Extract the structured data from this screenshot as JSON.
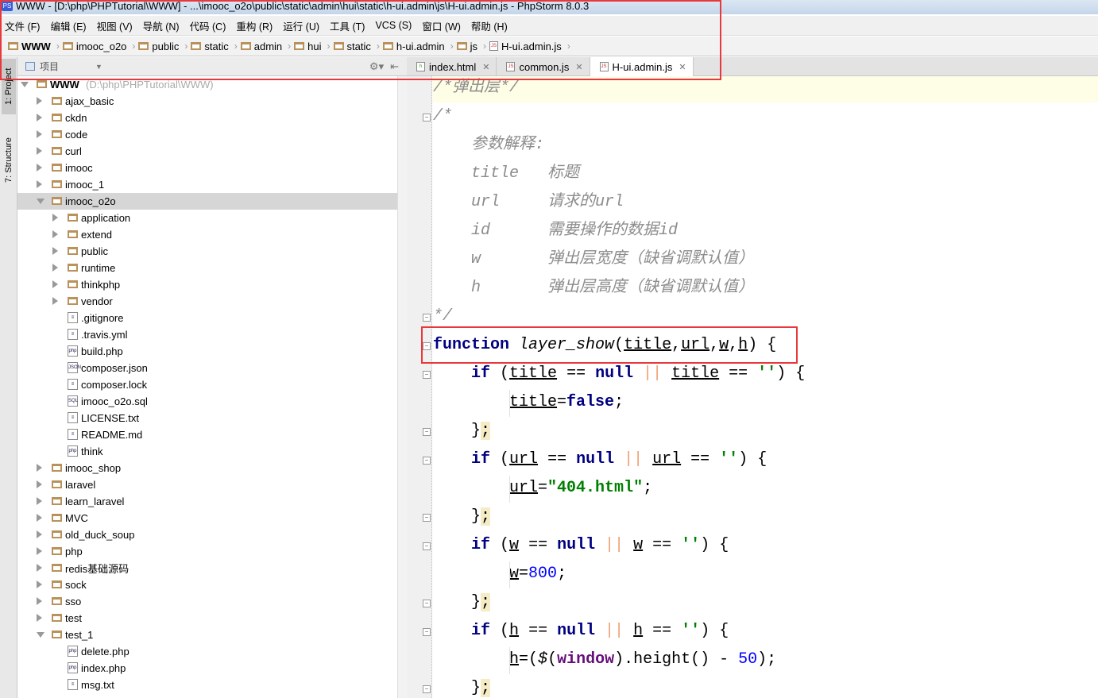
{
  "window": {
    "title": "WWW - [D:\\php\\PHPTutorial\\WWW] - ...\\imooc_o2o\\public\\static\\admin\\hui\\static\\h-ui.admin\\js\\H-ui.admin.js - PhpStorm 8.0.3"
  },
  "menu": [
    "文件 (F)",
    "编辑 (E)",
    "视图 (V)",
    "导航 (N)",
    "代码 (C)",
    "重构 (R)",
    "运行 (U)",
    "工具 (T)",
    "VCS (S)",
    "窗口 (W)",
    "帮助 (H)"
  ],
  "breadcrumb": [
    "WWW",
    "imooc_o2o",
    "public",
    "static",
    "admin",
    "hui",
    "static",
    "h-ui.admin",
    "js",
    "H-ui.admin.js"
  ],
  "sidebar": {
    "tabs": [
      "1: Project",
      "7: Structure"
    ],
    "panel_title": "项目"
  },
  "tabs": [
    {
      "label": "index.html",
      "icon": "html-file-icon"
    },
    {
      "label": "common.js",
      "icon": "js-file-icon"
    },
    {
      "label": "H-ui.admin.js",
      "icon": "js-file-icon",
      "active": true
    }
  ],
  "tree": [
    {
      "label": "WWW",
      "hint": "(D:\\php\\PHPTutorial\\WWW)",
      "depth": 0,
      "kind": "folder",
      "state": "open"
    },
    {
      "label": "ajax_basic",
      "depth": 1,
      "kind": "folder",
      "state": "closed"
    },
    {
      "label": "ckdn",
      "depth": 1,
      "kind": "folder",
      "state": "closed"
    },
    {
      "label": "code",
      "depth": 1,
      "kind": "folder",
      "state": "closed"
    },
    {
      "label": "curl",
      "depth": 1,
      "kind": "folder",
      "state": "closed"
    },
    {
      "label": "imooc",
      "depth": 1,
      "kind": "folder",
      "state": "closed"
    },
    {
      "label": "imooc_1",
      "depth": 1,
      "kind": "folder",
      "state": "closed"
    },
    {
      "label": "imooc_o2o",
      "depth": 1,
      "kind": "folder",
      "state": "open",
      "selected": true
    },
    {
      "label": "application",
      "depth": 2,
      "kind": "folder",
      "state": "closed"
    },
    {
      "label": "extend",
      "depth": 2,
      "kind": "folder",
      "state": "closed"
    },
    {
      "label": "public",
      "depth": 2,
      "kind": "folder",
      "state": "closed"
    },
    {
      "label": "runtime",
      "depth": 2,
      "kind": "folder",
      "state": "closed"
    },
    {
      "label": "thinkphp",
      "depth": 2,
      "kind": "folder",
      "state": "closed"
    },
    {
      "label": "vendor",
      "depth": 2,
      "kind": "folder",
      "state": "closed"
    },
    {
      "label": ".gitignore",
      "depth": 2,
      "kind": "text"
    },
    {
      "label": ".travis.yml",
      "depth": 2,
      "kind": "yml"
    },
    {
      "label": "build.php",
      "depth": 2,
      "kind": "php"
    },
    {
      "label": "composer.json",
      "depth": 2,
      "kind": "json"
    },
    {
      "label": "composer.lock",
      "depth": 2,
      "kind": "text"
    },
    {
      "label": "imooc_o2o.sql",
      "depth": 2,
      "kind": "sql"
    },
    {
      "label": "LICENSE.txt",
      "depth": 2,
      "kind": "text"
    },
    {
      "label": "README.md",
      "depth": 2,
      "kind": "text"
    },
    {
      "label": "think",
      "depth": 2,
      "kind": "php"
    },
    {
      "label": "imooc_shop",
      "depth": 1,
      "kind": "folder",
      "state": "closed"
    },
    {
      "label": "laravel",
      "depth": 1,
      "kind": "folder",
      "state": "closed"
    },
    {
      "label": "learn_laravel",
      "depth": 1,
      "kind": "folder",
      "state": "closed"
    },
    {
      "label": "MVC",
      "depth": 1,
      "kind": "folder",
      "state": "closed"
    },
    {
      "label": "old_duck_soup",
      "depth": 1,
      "kind": "folder",
      "state": "closed"
    },
    {
      "label": "php",
      "depth": 1,
      "kind": "folder",
      "state": "closed"
    },
    {
      "label": "redis基础源码",
      "depth": 1,
      "kind": "folder",
      "state": "closed"
    },
    {
      "label": "sock",
      "depth": 1,
      "kind": "folder",
      "state": "closed"
    },
    {
      "label": "sso",
      "depth": 1,
      "kind": "folder",
      "state": "closed"
    },
    {
      "label": "test",
      "depth": 1,
      "kind": "folder",
      "state": "closed"
    },
    {
      "label": "test_1",
      "depth": 1,
      "kind": "folder",
      "state": "open"
    },
    {
      "label": "delete.php",
      "depth": 2,
      "kind": "php"
    },
    {
      "label": "index.php",
      "depth": 2,
      "kind": "php"
    },
    {
      "label": "msg.txt",
      "depth": 2,
      "kind": "text"
    }
  ],
  "code": [
    {
      "fold": "",
      "hl": true,
      "tokens": [
        [
          "/*弹出层*/",
          "cm"
        ]
      ]
    },
    {
      "fold": "open",
      "tokens": [
        [
          "/*",
          "cm"
        ]
      ]
    },
    {
      "tokens": [
        [
          "    参数解释:",
          "cm"
        ]
      ]
    },
    {
      "tokens": [
        [
          "    title   标题",
          "cm"
        ]
      ]
    },
    {
      "tokens": [
        [
          "    url     请求的url",
          "cm"
        ]
      ]
    },
    {
      "tokens": [
        [
          "    id      需要操作的数据id",
          "cm"
        ]
      ]
    },
    {
      "tokens": [
        [
          "    w       弹出层宽度（缺省调默认值）",
          "cm"
        ]
      ]
    },
    {
      "tokens": [
        [
          "    h       弹出层高度（缺省调默认值）",
          "cm"
        ]
      ]
    },
    {
      "fold": "close",
      "tokens": [
        [
          "*/",
          "cm"
        ]
      ]
    },
    {
      "fold": "open",
      "tokens": [
        [
          "function",
          "kw"
        ],
        [
          " ",
          ""
        ],
        [
          "layer_show",
          "fn"
        ],
        [
          "(",
          ""
        ],
        [
          "title",
          "pr"
        ],
        [
          ",",
          ""
        ],
        [
          "url",
          "pr"
        ],
        [
          ",",
          ""
        ],
        [
          "w",
          "pr"
        ],
        [
          ",",
          ""
        ],
        [
          "h",
          "pr"
        ],
        [
          ") {",
          ""
        ]
      ]
    },
    {
      "fold": "open",
      "tokens": [
        [
          "    ",
          ""
        ],
        [
          "if",
          "kw"
        ],
        [
          " (",
          ""
        ],
        [
          "title",
          "pr"
        ],
        [
          " == ",
          ""
        ],
        [
          "null",
          "kw"
        ],
        [
          " ",
          ""
        ],
        [
          "||",
          "op"
        ],
        [
          " ",
          ""
        ],
        [
          "title",
          "pr"
        ],
        [
          " == ",
          ""
        ],
        [
          "''",
          "st"
        ],
        [
          ") {",
          ""
        ]
      ]
    },
    {
      "tokens": [
        [
          "        ",
          ""
        ],
        [
          "title",
          "pr"
        ],
        [
          "=",
          ""
        ],
        [
          "false",
          "kw"
        ],
        [
          ";",
          ""
        ]
      ]
    },
    {
      "fold": "close",
      "tokens": [
        [
          "    }",
          ""
        ],
        [
          ";",
          "br"
        ]
      ]
    },
    {
      "fold": "open",
      "tokens": [
        [
          "    ",
          ""
        ],
        [
          "if",
          "kw"
        ],
        [
          " (",
          ""
        ],
        [
          "url",
          "pr"
        ],
        [
          " == ",
          ""
        ],
        [
          "null",
          "kw"
        ],
        [
          " ",
          ""
        ],
        [
          "||",
          "op"
        ],
        [
          " ",
          ""
        ],
        [
          "url",
          "pr"
        ],
        [
          " == ",
          ""
        ],
        [
          "''",
          "st"
        ],
        [
          ") {",
          ""
        ]
      ]
    },
    {
      "tokens": [
        [
          "        ",
          ""
        ],
        [
          "url",
          "pr"
        ],
        [
          "=",
          ""
        ],
        [
          "\"404.html\"",
          "st"
        ],
        [
          ";",
          ""
        ]
      ]
    },
    {
      "fold": "close",
      "tokens": [
        [
          "    }",
          ""
        ],
        [
          ";",
          "br"
        ]
      ]
    },
    {
      "fold": "open",
      "tokens": [
        [
          "    ",
          ""
        ],
        [
          "if",
          "kw"
        ],
        [
          " (",
          ""
        ],
        [
          "w",
          "pr"
        ],
        [
          " == ",
          ""
        ],
        [
          "null",
          "kw"
        ],
        [
          " ",
          ""
        ],
        [
          "||",
          "op"
        ],
        [
          " ",
          ""
        ],
        [
          "w",
          "pr"
        ],
        [
          " == ",
          ""
        ],
        [
          "''",
          "st"
        ],
        [
          ") {",
          ""
        ]
      ]
    },
    {
      "tokens": [
        [
          "        ",
          ""
        ],
        [
          "w",
          "pr"
        ],
        [
          "=",
          ""
        ],
        [
          "800",
          "nu"
        ],
        [
          ";",
          ""
        ]
      ]
    },
    {
      "fold": "close",
      "tokens": [
        [
          "    }",
          ""
        ],
        [
          ";",
          "br"
        ]
      ]
    },
    {
      "fold": "open",
      "tokens": [
        [
          "    ",
          ""
        ],
        [
          "if",
          "kw"
        ],
        [
          " (",
          ""
        ],
        [
          "h",
          "pr"
        ],
        [
          " == ",
          ""
        ],
        [
          "null",
          "kw"
        ],
        [
          " ",
          ""
        ],
        [
          "||",
          "op"
        ],
        [
          " ",
          ""
        ],
        [
          "h",
          "pr"
        ],
        [
          " == ",
          ""
        ],
        [
          "''",
          "st"
        ],
        [
          ") {",
          ""
        ]
      ]
    },
    {
      "tokens": [
        [
          "        ",
          ""
        ],
        [
          "h",
          "pr"
        ],
        [
          "=(",
          ""
        ],
        [
          "$",
          "fn"
        ],
        [
          "(",
          ""
        ],
        [
          "window",
          "gl"
        ],
        [
          ").height() - ",
          ""
        ],
        [
          "50",
          "nu"
        ],
        [
          ");",
          ""
        ]
      ]
    },
    {
      "fold": "close",
      "tokens": [
        [
          "    }",
          ""
        ],
        [
          ";",
          "br"
        ]
      ]
    }
  ],
  "colors": {
    "highlight_box": "#e8383d",
    "keyword": "#000080",
    "string": "#008000",
    "number": "#0000ff",
    "comment": "#8c8c8c"
  }
}
